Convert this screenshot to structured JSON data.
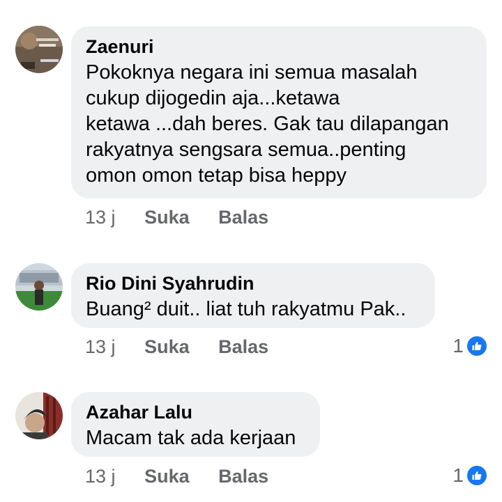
{
  "comments": [
    {
      "author": "Zaenuri",
      "lines": [
        "Pokoknya negara ini semua masalah",
        "cukup dijogedin aja...ketawa",
        "ketawa ...dah beres. Gak tau dilapangan",
        "rakyatnya sengsara semua..penting",
        "omon omon tetap bisa heppy"
      ],
      "time": "13 j",
      "like_label": "Suka",
      "reply_label": "Balas",
      "reaction_count": null,
      "avatar_icon": "profile-avatar-icon"
    },
    {
      "author": "Rio Dini Syahrudin",
      "lines": [
        "Buang² duit.. liat tuh rakyatmu Pak.."
      ],
      "time": "13 j",
      "like_label": "Suka",
      "reply_label": "Balas",
      "reaction_count": "1",
      "avatar_icon": "profile-avatar-icon"
    },
    {
      "author": "Azahar Lalu",
      "lines": [
        "Macam tak ada kerjaan"
      ],
      "time": "13 j",
      "like_label": "Suka",
      "reply_label": "Balas",
      "reaction_count": "1",
      "avatar_icon": "profile-avatar-icon"
    }
  ],
  "colors": {
    "bubble": "#eff0f2",
    "secondary_text": "#65676b",
    "like_badge": "#1877f2"
  },
  "reaction_icon": "thumbs-up-icon"
}
